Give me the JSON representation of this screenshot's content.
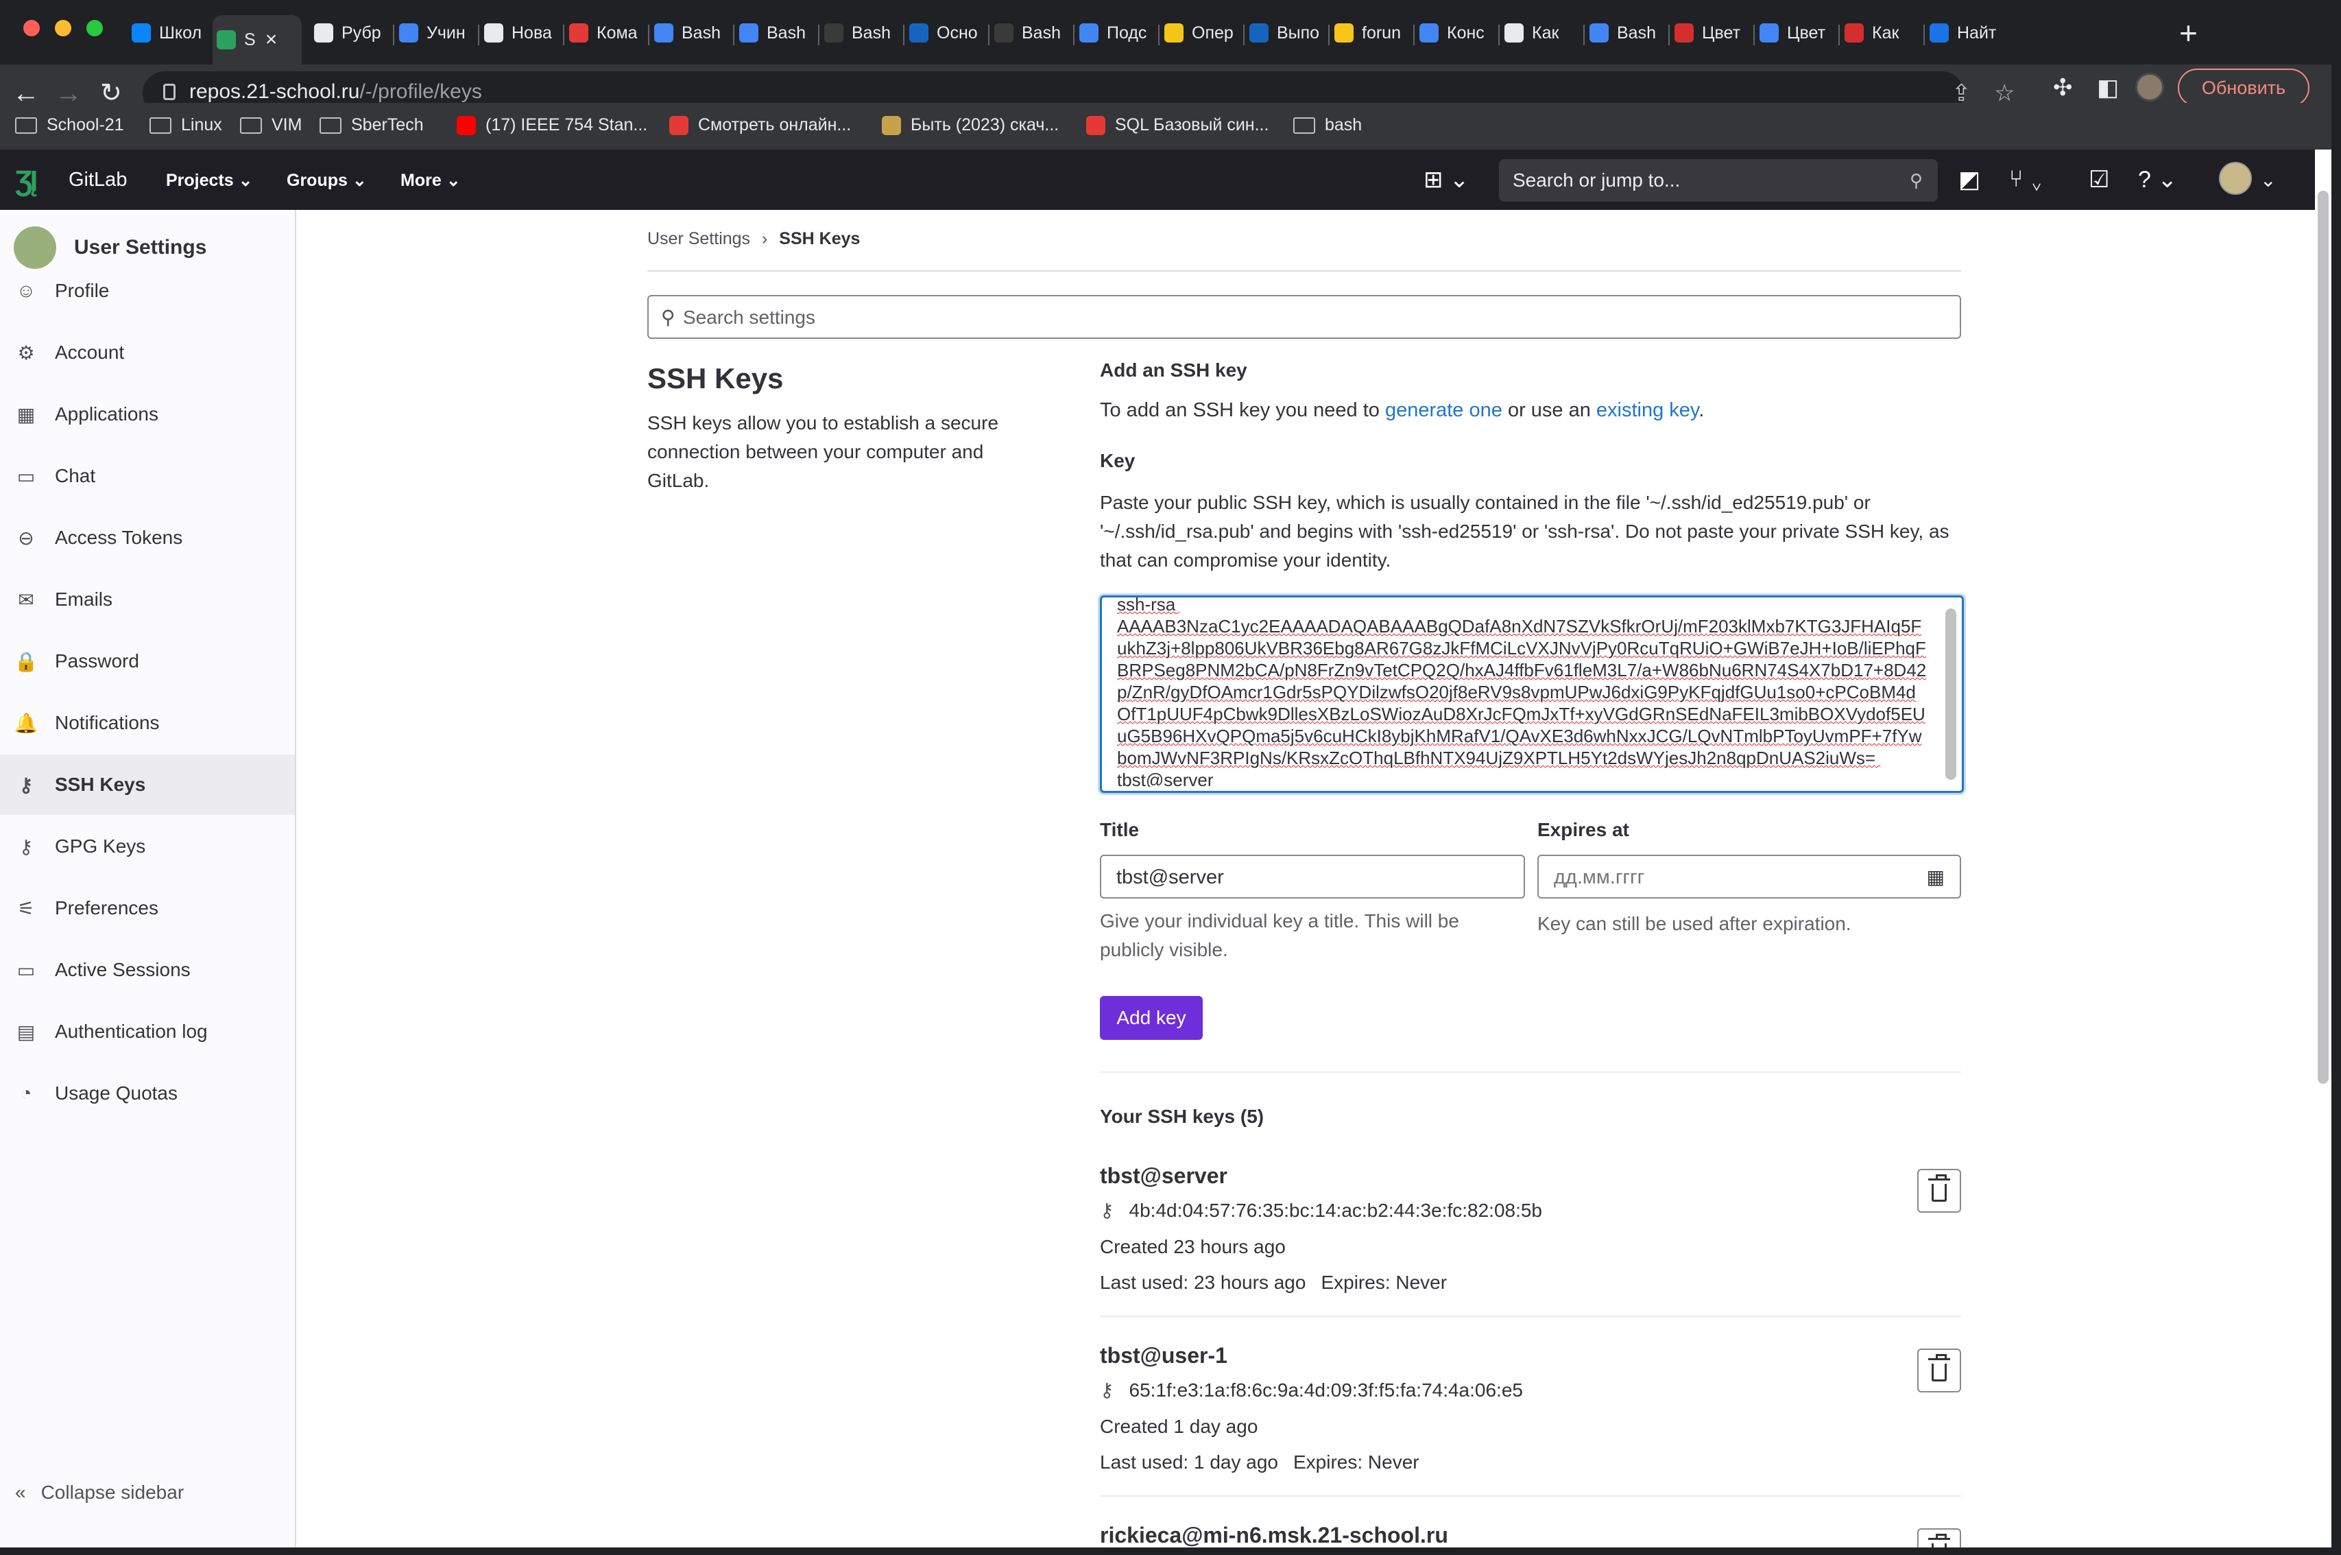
{
  "browser": {
    "tabs": [
      {
        "label": "Школ",
        "color": "#0a84ff"
      },
      {
        "label": "S",
        "color": "#2da160",
        "active": true
      },
      {
        "label": "Рубр",
        "color": "#e8eaed"
      },
      {
        "label": "Учин",
        "color": "#4285f4"
      },
      {
        "label": "Нова",
        "color": "#e8eaed"
      },
      {
        "label": "Кома",
        "color": "#e53935"
      },
      {
        "label": "Bash",
        "color": "#4285f4"
      },
      {
        "label": "Bash",
        "color": "#4285f4"
      },
      {
        "label": "Bash",
        "color": "#3a3a3a"
      },
      {
        "label": "Осно",
        "color": "#1565c0"
      },
      {
        "label": "Bash",
        "color": "#3a3a3a"
      },
      {
        "label": "Подс",
        "color": "#4285f4"
      },
      {
        "label": "Опер",
        "color": "#f5c518"
      },
      {
        "label": "Выпо",
        "color": "#1565c0"
      },
      {
        "label": "forun",
        "color": "#f5c518"
      },
      {
        "label": "Конс",
        "color": "#4285f4"
      },
      {
        "label": "Как",
        "color": "#e8eaed"
      },
      {
        "label": "Bash",
        "color": "#4285f4"
      },
      {
        "label": "Цвет",
        "color": "#d32f2f"
      },
      {
        "label": "Цвет",
        "color": "#4285f4"
      },
      {
        "label": "Как",
        "color": "#d32f2f"
      },
      {
        "label": "Найт",
        "color": "#1a73e8"
      }
    ],
    "url_host": "repos.21-school.ru",
    "url_path": "/-/profile/keys",
    "update_label": "Обновить",
    "bookmarks": [
      {
        "label": "School-21",
        "type": "folder"
      },
      {
        "label": "Linux",
        "type": "folder"
      },
      {
        "label": "VIM",
        "type": "folder"
      },
      {
        "label": "SberTech",
        "type": "folder"
      },
      {
        "label": "(17) IEEE 754 Stan...",
        "type": "youtube",
        "color": "#ff0000"
      },
      {
        "label": "Смотреть онлайн...",
        "type": "site",
        "color": "#e53935"
      },
      {
        "label": "Быть (2023) скач...",
        "type": "site",
        "color": "#c8a24a"
      },
      {
        "label": "SQL Базовый син...",
        "type": "site",
        "color": "#e53935"
      },
      {
        "label": "bash",
        "type": "folder"
      }
    ]
  },
  "gitlab": {
    "brand": "GitLab",
    "menu": [
      "Projects",
      "Groups",
      "More"
    ],
    "search_placeholder": "Search or jump to..."
  },
  "sidebar": {
    "title": "User Settings",
    "items": [
      {
        "label": "Profile",
        "icon": "profile-icon",
        "glyph": "☺"
      },
      {
        "label": "Account",
        "icon": "account-icon",
        "glyph": "⚙"
      },
      {
        "label": "Applications",
        "icon": "applications-icon",
        "glyph": "▦"
      },
      {
        "label": "Chat",
        "icon": "chat-icon",
        "glyph": "▭"
      },
      {
        "label": "Access Tokens",
        "icon": "token-icon",
        "glyph": "⊖"
      },
      {
        "label": "Emails",
        "icon": "email-icon",
        "glyph": "✉"
      },
      {
        "label": "Password",
        "icon": "lock-icon",
        "glyph": "🔒"
      },
      {
        "label": "Notifications",
        "icon": "bell-icon",
        "glyph": "🔔"
      },
      {
        "label": "SSH Keys",
        "icon": "key-icon",
        "glyph": "⚷",
        "active": true
      },
      {
        "label": "GPG Keys",
        "icon": "key-icon",
        "glyph": "⚷"
      },
      {
        "label": "Preferences",
        "icon": "preferences-icon",
        "glyph": "⚟"
      },
      {
        "label": "Active Sessions",
        "icon": "monitor-icon",
        "glyph": "▭"
      },
      {
        "label": "Authentication log",
        "icon": "log-icon",
        "glyph": "▤"
      },
      {
        "label": "Usage Quotas",
        "icon": "quota-icon",
        "glyph": "◔"
      }
    ],
    "collapse_label": "Collapse sidebar"
  },
  "breadcrumb": {
    "parent": "User Settings",
    "current": "SSH Keys"
  },
  "settings_search_placeholder": "Search settings",
  "section": {
    "title": "SSH Keys",
    "description": "SSH keys allow you to establish a secure connection between your computer and GitLab."
  },
  "add_key": {
    "heading": "Add an SSH key",
    "intro_prefix": "To add an SSH key you need to ",
    "link1": "generate one",
    "intro_mid": " or use an ",
    "link2": "existing key",
    "intro_suffix": ".",
    "key_label": "Key",
    "key_help": "Paste your public SSH key, which is usually contained in the file '~/.ssh/id_ed25519.pub' or '~/.ssh/id_rsa.pub' and begins with 'ssh-ed25519' or 'ssh-rsa'. Do not paste your private SSH key, as that can compromise your identity.",
    "key_value": "ssh-rsa AAAAB3NzaC1yc2EAAAADAQABAAABgQDafA8nXdN7SZVkSfkrOrUj/mF203klMxb7KTG3JFHAIq5FukhZ3j+8lpp806UkVBR36Ebg8AR67G8zJkFfMCiLcVXJNvVjPy0RcuTqRUiO+GWiB7eJH+IoB/liEPhqFBRPSeg8PNM2bCA/pN8FrZn9vTetCPQ2Q/hxAJ4ffbFv61fleM3L7/a+W86bNu6RN74S4X7bD17+8D42p/ZnR/gyDfOAmcr1Gdr5sPQYDilzwfsO20jf8eRV9s8vpmUPwJ6dxiG9PyKFqjdfGUu1so0+cPCoBM4dOfT1pUUF4pCbwk9DllesXBzLoSWiozAuD8XrJcFQmJxTf+xyVGdGRnSEdNaFEIL3mibBOXVydof5EUuG5B96HXvQPQma5j5v6cuHCkI8ybjKhMRafV1/QAvXE3d6whNxxJCG/LQvNTmlbPToyUvmPF+7fYwbomJWvNF3RPIgNs/KRsxZcOThqLBfhNTX94UjZ9XPTLH5Yt2dsWYjesJh2n8qpDnUAS2iuWs= tbst@server",
    "title_label": "Title",
    "title_value": "tbst@server",
    "title_hint": "Give your individual key a title. This will be publicly visible.",
    "expires_label": "Expires at",
    "expires_placeholder": "дд.мм.гггг",
    "expires_hint": "Key can still be used after expiration.",
    "submit_label": "Add key"
  },
  "your_keys": {
    "heading": "Your SSH keys (5)",
    "keys": [
      {
        "title": "tbst@server",
        "fingerprint": "4b:4d:04:57:76:35:bc:14:ac:b2:44:3e:fc:82:08:5b",
        "created": "Created 23 hours ago",
        "last_used": "Last used: 23 hours ago",
        "expires": "Expires: Never"
      },
      {
        "title": "tbst@user-1",
        "fingerprint": "65:1f:e3:1a:f8:6c:9a:4d:09:3f:f5:fa:74:4a:06:e5",
        "created": "Created 1 day ago",
        "last_used": "Last used: 1 day ago",
        "expires": "Expires: Never"
      },
      {
        "title": "rickieca@mi-n6.msk.21-school.ru",
        "fingerprint": "",
        "created": "",
        "last_used": "",
        "expires": ""
      }
    ]
  }
}
